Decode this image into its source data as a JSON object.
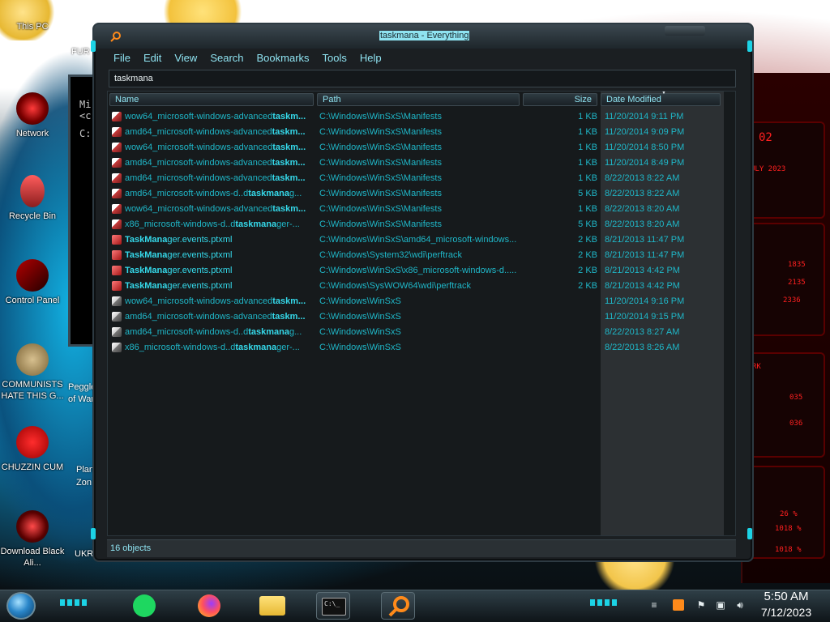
{
  "desktop": {
    "icons": [
      {
        "label": "This PC"
      },
      {
        "label": "Network"
      },
      {
        "label": "Recycle Bin"
      },
      {
        "label": "Control Panel"
      },
      {
        "label": "COMMUNISTS HATE THIS G..."
      },
      {
        "label": "CHUZZIN CUM"
      },
      {
        "label": "Download Black Ali..."
      }
    ],
    "partial_icons": [
      {
        "label": "FUR"
      },
      {
        "label": "Peggle"
      },
      {
        "label": "of War"
      },
      {
        "label": "Plan"
      },
      {
        "label": "Zon"
      },
      {
        "label": "UKR"
      }
    ],
    "cmd_lines": [
      "Mi",
      "<c",
      "C:"
    ],
    "widget_texts": [
      "02",
      "ULY 2023",
      "1835",
      "2135",
      "2336",
      "RK",
      "035",
      "036",
      "26 %",
      "1018 %",
      "1018 %"
    ]
  },
  "window": {
    "title": "taskmana - Everything",
    "menu": [
      "File",
      "Edit",
      "View",
      "Search",
      "Bookmarks",
      "Tools",
      "Help"
    ],
    "search_value": "taskmana",
    "columns": {
      "name": "Name",
      "path": "Path",
      "size": "Size",
      "date": "Date Modified"
    },
    "rows": [
      {
        "icon": "manifest-icon",
        "pre": "wow64_microsoft-windows-advanced",
        "hl": "taskm...",
        "post": "",
        "path": "C:\\Windows\\WinSxS\\Manifests",
        "size": "1 KB",
        "date": "11/20/2014 9:11 PM"
      },
      {
        "icon": "manifest-icon",
        "pre": "amd64_microsoft-windows-advanced",
        "hl": "taskm...",
        "post": "",
        "path": "C:\\Windows\\WinSxS\\Manifests",
        "size": "1 KB",
        "date": "11/20/2014 9:09 PM"
      },
      {
        "icon": "manifest-icon",
        "pre": "wow64_microsoft-windows-advanced",
        "hl": "taskm...",
        "post": "",
        "path": "C:\\Windows\\WinSxS\\Manifests",
        "size": "1 KB",
        "date": "11/20/2014 8:50 PM"
      },
      {
        "icon": "manifest-icon",
        "pre": "amd64_microsoft-windows-advanced",
        "hl": "taskm...",
        "post": "",
        "path": "C:\\Windows\\WinSxS\\Manifests",
        "size": "1 KB",
        "date": "11/20/2014 8:49 PM"
      },
      {
        "icon": "manifest-icon",
        "pre": "amd64_microsoft-windows-advanced",
        "hl": "taskm...",
        "post": "",
        "path": "C:\\Windows\\WinSxS\\Manifests",
        "size": "1 KB",
        "date": "8/22/2013 8:22 AM"
      },
      {
        "icon": "manifest-icon",
        "pre": "amd64_microsoft-windows-d..d",
        "hl": "taskmana",
        "post": "g...",
        "path": "C:\\Windows\\WinSxS\\Manifests",
        "size": "5 KB",
        "date": "8/22/2013 8:22 AM"
      },
      {
        "icon": "manifest-icon",
        "pre": "wow64_microsoft-windows-advanced",
        "hl": "taskm...",
        "post": "",
        "path": "C:\\Windows\\WinSxS\\Manifests",
        "size": "1 KB",
        "date": "8/22/2013 8:20 AM"
      },
      {
        "icon": "manifest-icon",
        "pre": "x86_microsoft-windows-d..d",
        "hl": "taskmana",
        "post": "ger-...",
        "path": "C:\\Windows\\WinSxS\\Manifests",
        "size": "5 KB",
        "date": "8/22/2013 8:20 AM"
      },
      {
        "icon": "ptxml-icon",
        "pre": "",
        "hl": "TaskMana",
        "post": "ger.events.ptxml",
        "path": "C:\\Windows\\WinSxS\\amd64_microsoft-windows...",
        "size": "2 KB",
        "date": "8/21/2013 11:47 PM"
      },
      {
        "icon": "ptxml-icon",
        "pre": "",
        "hl": "TaskMana",
        "post": "ger.events.ptxml",
        "path": "C:\\Windows\\System32\\wdi\\perftrack",
        "size": "2 KB",
        "date": "8/21/2013 11:47 PM"
      },
      {
        "icon": "ptxml-icon",
        "pre": "",
        "hl": "TaskMana",
        "post": "ger.events.ptxml",
        "path": "C:\\Windows\\WinSxS\\x86_microsoft-windows-d.....",
        "size": "2 KB",
        "date": "8/21/2013 4:42 PM"
      },
      {
        "icon": "ptxml-icon",
        "pre": "",
        "hl": "TaskMana",
        "post": "ger.events.ptxml",
        "path": "C:\\Windows\\SysWOW64\\wdi\\perftrack",
        "size": "2 KB",
        "date": "8/21/2013 4:42 PM"
      },
      {
        "icon": "folder-icon",
        "pre": "wow64_microsoft-windows-advanced",
        "hl": "taskm...",
        "post": "",
        "path": "C:\\Windows\\WinSxS",
        "size": "",
        "date": "11/20/2014 9:16 PM"
      },
      {
        "icon": "folder-icon",
        "pre": "amd64_microsoft-windows-advanced",
        "hl": "taskm...",
        "post": "",
        "path": "C:\\Windows\\WinSxS",
        "size": "",
        "date": "11/20/2014 9:15 PM"
      },
      {
        "icon": "folder-icon",
        "pre": "amd64_microsoft-windows-d..d",
        "hl": "taskmana",
        "post": "g...",
        "path": "C:\\Windows\\WinSxS",
        "size": "",
        "date": "8/22/2013 8:27 AM"
      },
      {
        "icon": "folder-icon",
        "pre": "x86_microsoft-windows-d..d",
        "hl": "taskmana",
        "post": "ger-...",
        "path": "C:\\Windows\\WinSxS",
        "size": "",
        "date": "8/22/2013 8:26 AM"
      }
    ],
    "status": "16 objects"
  },
  "taskbar": {
    "apps": [
      {
        "name": "spotify-icon"
      },
      {
        "name": "firefox-icon"
      },
      {
        "name": "file-explorer-icon"
      },
      {
        "name": "cmd-icon"
      },
      {
        "name": "everything-search-icon"
      }
    ],
    "cmd_glyph": "C:\\_",
    "time": "5:50 AM",
    "date": "7/12/2023"
  },
  "colors": {
    "accent": "#35d9ea",
    "text_cyan": "#1fb7c8",
    "window_bg": "#1b1f22",
    "wallpaper_red": "#ff2020"
  }
}
